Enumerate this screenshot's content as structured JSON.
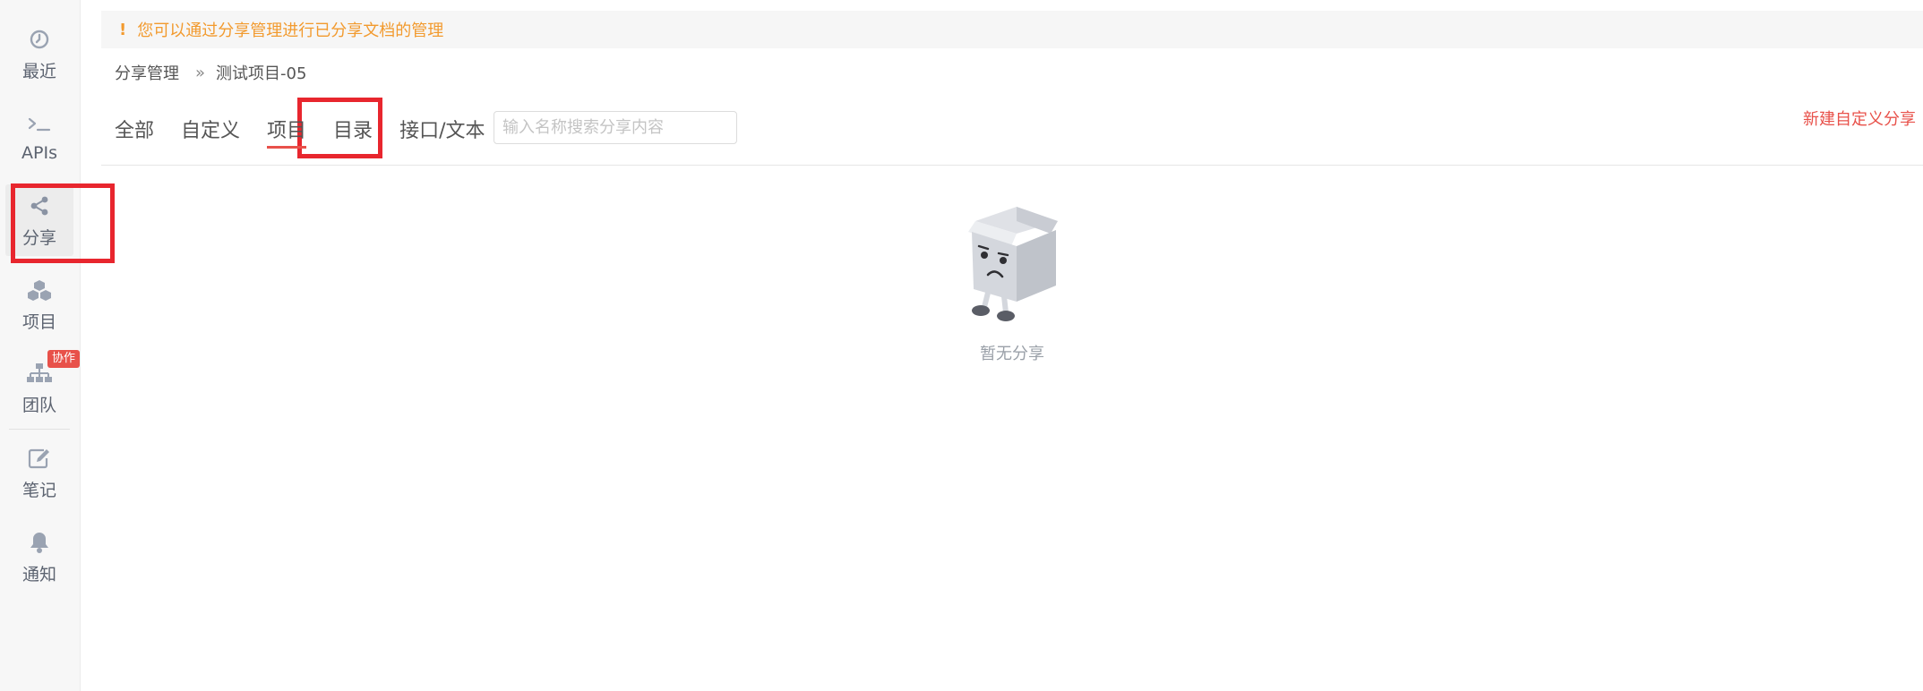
{
  "sidebar": {
    "items": [
      {
        "label": "最近",
        "icon": "clock-icon"
      },
      {
        "label": "APIs",
        "icon": "terminal-icon"
      },
      {
        "label": "分享",
        "icon": "share-icon",
        "active": true
      },
      {
        "label": "项目",
        "icon": "cubes-icon"
      },
      {
        "label": "团队",
        "icon": "org-chart-icon",
        "badge": "协作"
      },
      {
        "label": "笔记",
        "icon": "edit-icon"
      },
      {
        "label": "通知",
        "icon": "bell-icon"
      }
    ]
  },
  "notice": {
    "icon": "!",
    "text": "您可以通过分享管理进行已分享文档的管理"
  },
  "breadcrumb": {
    "root": "分享管理",
    "separator": "»",
    "current": "测试项目-05"
  },
  "tabs": [
    {
      "label": "全部"
    },
    {
      "label": "自定义"
    },
    {
      "label": "项目",
      "active": true
    },
    {
      "label": "目录"
    },
    {
      "label": "接口/文本"
    }
  ],
  "search": {
    "placeholder": "输入名称搜索分享内容",
    "value": ""
  },
  "actions": {
    "new_share": "新建自定义分享"
  },
  "empty": {
    "text": "暂无分享"
  },
  "colors": {
    "accent": "#e8514a",
    "warning": "#f29a2e",
    "highlight": "#e8262e"
  }
}
